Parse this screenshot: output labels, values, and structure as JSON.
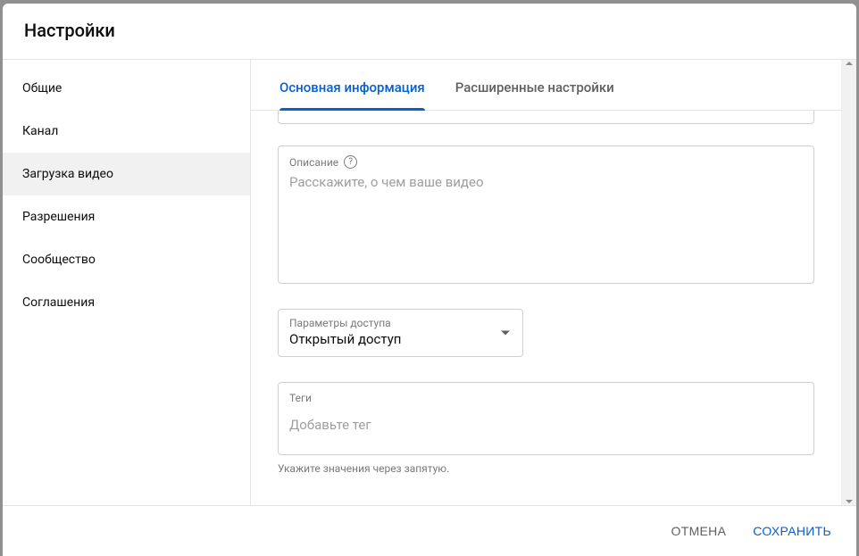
{
  "header": {
    "title": "Настройки"
  },
  "sidebar": {
    "items": [
      {
        "label": "Общие",
        "active": false
      },
      {
        "label": "Канал",
        "active": false
      },
      {
        "label": "Загрузка видео",
        "active": true
      },
      {
        "label": "Разрешения",
        "active": false
      },
      {
        "label": "Сообщество",
        "active": false
      },
      {
        "label": "Соглашения",
        "active": false
      }
    ]
  },
  "tabs": [
    {
      "label": "Основная информация",
      "active": true
    },
    {
      "label": "Расширенные настройки",
      "active": false
    }
  ],
  "form": {
    "description": {
      "label": "Описание",
      "placeholder": "Расскажите, о чем ваше видео",
      "value": ""
    },
    "access": {
      "label": "Параметры доступа",
      "value": "Открытый доступ"
    },
    "tags": {
      "label": "Теги",
      "placeholder": "Добавьте тег",
      "value": "",
      "hint": "Укажите значения через запятую."
    }
  },
  "footer": {
    "cancel": "ОТМЕНА",
    "save": "СОХРАНИТЬ"
  }
}
